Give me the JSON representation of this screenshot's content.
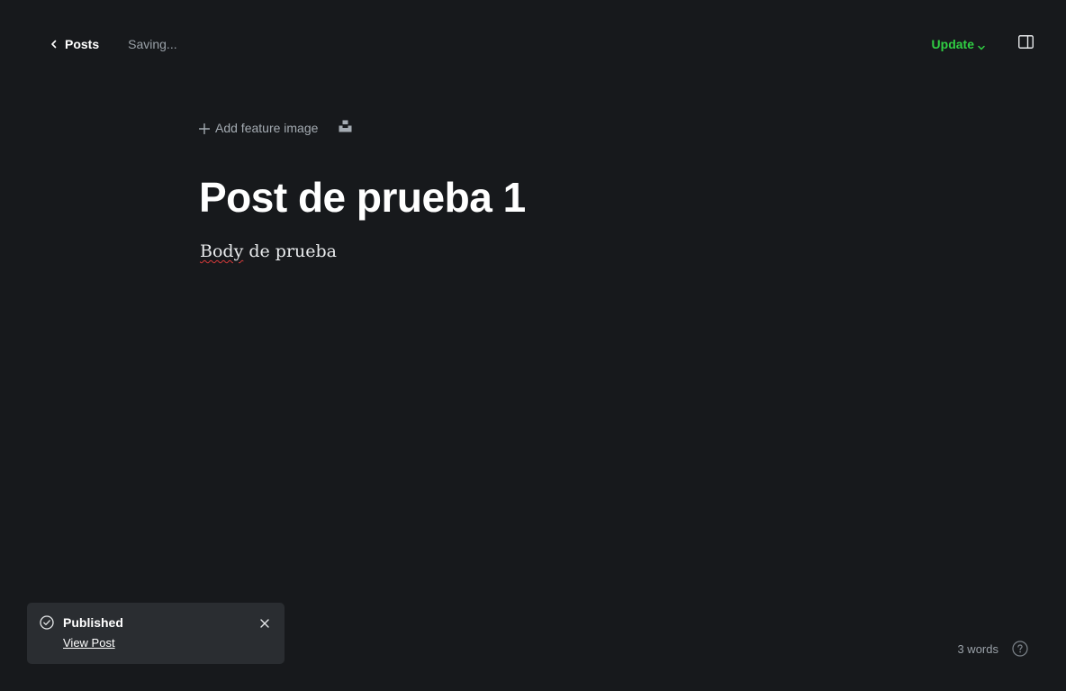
{
  "header": {
    "back_label": "Posts",
    "status": "Saving...",
    "update_label": "Update",
    "icons": {
      "back": "chevron-left-icon",
      "update_dropdown": "chevron-down-icon",
      "sidebar": "sidebar-panel-icon"
    }
  },
  "editor": {
    "add_feature_label": "Add feature image",
    "title": "Post de prueba 1",
    "body": {
      "misspelled": "Body",
      "rest": " de prueba"
    },
    "icons": {
      "add": "plus-icon",
      "unsplash": "unsplash-icon"
    }
  },
  "toast": {
    "title": "Published",
    "link": "View Post",
    "icons": {
      "status": "check-circle-icon",
      "close": "close-icon"
    }
  },
  "footer": {
    "word_count": "3 words",
    "icons": {
      "help": "help-circle-icon"
    }
  },
  "colors": {
    "background": "#17191c",
    "accent": "#30cf43",
    "toast_bg": "#2a2d31",
    "muted_text": "#9aa1a8"
  }
}
